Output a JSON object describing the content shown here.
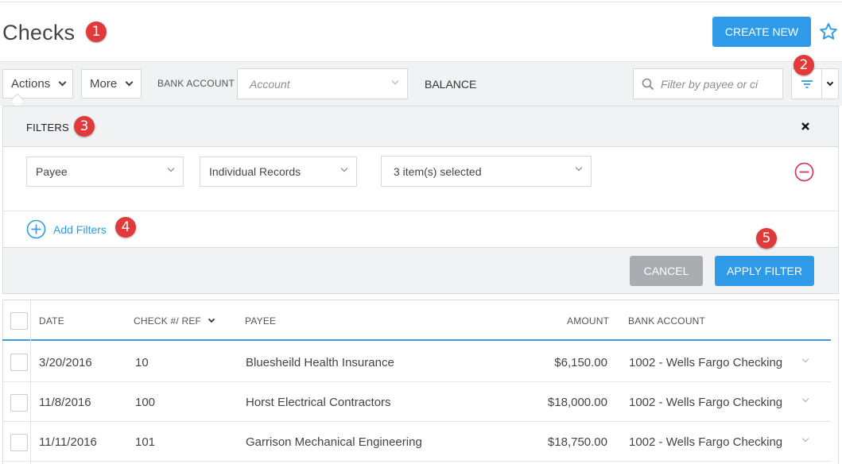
{
  "page": {
    "title": "Checks"
  },
  "header": {
    "create_new_label": "CREATE NEW",
    "favorite_icon": "star-icon"
  },
  "badges": [
    "1",
    "2",
    "3",
    "4",
    "5"
  ],
  "toolbar": {
    "actions_label": "Actions",
    "more_label": "More",
    "bank_account_label": "BANK ACCOUNT",
    "account_placeholder": "Account",
    "balance_label": "BALANCE",
    "search_placeholder": "Filter by payee or ci"
  },
  "filters": {
    "title": "FILTERS",
    "field": "Payee",
    "mode": "Individual Records",
    "selection": "3 item(s) selected",
    "add_filters_label": "Add Filters",
    "cancel_label": "CANCEL",
    "apply_label": "APPLY FILTER"
  },
  "table": {
    "columns": [
      "DATE",
      "CHECK #/ REF",
      "PAYEE",
      "AMOUNT",
      "BANK ACCOUNT"
    ],
    "rows": [
      {
        "date": "3/20/2016",
        "ref": "10",
        "payee": "Bluesheild Health Insurance",
        "amount": "$6,150.00",
        "account": "1002 - Wells Fargo Checking"
      },
      {
        "date": "11/8/2016",
        "ref": "100",
        "payee": "Horst Electrical Contractors",
        "amount": "$18,000.00",
        "account": "1002 - Wells Fargo Checking"
      },
      {
        "date": "11/11/2016",
        "ref": "101",
        "payee": "Garrison Mechanical Engineering",
        "amount": "$18,750.00",
        "account": "1002 - Wells Fargo Checking"
      }
    ]
  },
  "colors": {
    "accent": "#2f9ae8",
    "badge": "#e03a3a",
    "remove": "#d23a62"
  }
}
